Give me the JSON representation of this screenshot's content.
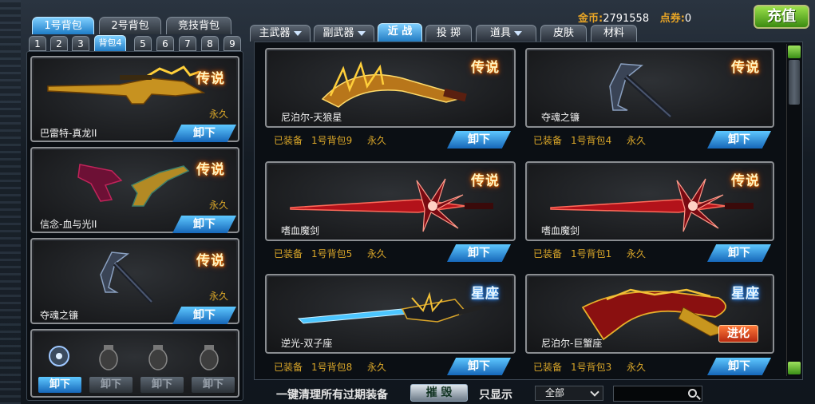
{
  "top": {
    "gold_label": "金币:",
    "gold_value": "2791558",
    "points_label": "点券:",
    "points_value": "0",
    "recharge_label": "充值"
  },
  "pack_tabs": [
    "1号背包",
    "2号背包",
    "竞技背包"
  ],
  "pack_numbers": [
    "1",
    "2",
    "3",
    "背包4",
    "5",
    "6",
    "7",
    "8",
    "9"
  ],
  "left_slots": [
    {
      "name": "巴雷特-真龙II",
      "badge": "传说",
      "duration": "永久",
      "button": "卸下"
    },
    {
      "name": "信念-血与光II",
      "badge": "传说",
      "duration": "永久",
      "button": "卸下"
    },
    {
      "name": "夺魂之镰",
      "badge": "传说",
      "duration": "永久",
      "button": "卸下"
    }
  ],
  "grenade_buttons": [
    "卸下",
    "卸下",
    "卸下",
    "卸下"
  ],
  "category_tabs": [
    "主武器",
    "副武器",
    "近 战",
    "投 掷",
    "道具",
    "皮肤",
    "材料"
  ],
  "items": [
    {
      "name": "尼泊尔-天狼星",
      "badge": "传说",
      "equipped": "已装备",
      "pack": "1号背包9",
      "duration": "永久",
      "button": "卸下"
    },
    {
      "name": "夺魂之镰",
      "badge": "传说",
      "equipped": "已装备",
      "pack": "1号背包4",
      "duration": "永久",
      "button": "卸下"
    },
    {
      "name": "嗜血魔剑",
      "badge": "传说",
      "equipped": "已装备",
      "pack": "1号背包5",
      "duration": "永久",
      "button": "卸下"
    },
    {
      "name": "嗜血魔剑",
      "badge": "传说",
      "equipped": "已装备",
      "pack": "1号背包1",
      "duration": "永久",
      "button": "卸下"
    },
    {
      "name": "逆光-双子座",
      "badge": "星座",
      "equipped": "已装备",
      "pack": "1号背包8",
      "duration": "永久",
      "button": "卸下"
    },
    {
      "name": "尼泊尔-巨蟹座",
      "badge": "星座",
      "equipped": "已装备",
      "pack": "1号背包3",
      "duration": "永久",
      "button": "卸下",
      "extra": "进化"
    }
  ],
  "bottom": {
    "clean_label": "一键清理所有过期装备",
    "destroy_label": "摧 毁",
    "filter_label": "只显示",
    "filter_value": "全部"
  }
}
